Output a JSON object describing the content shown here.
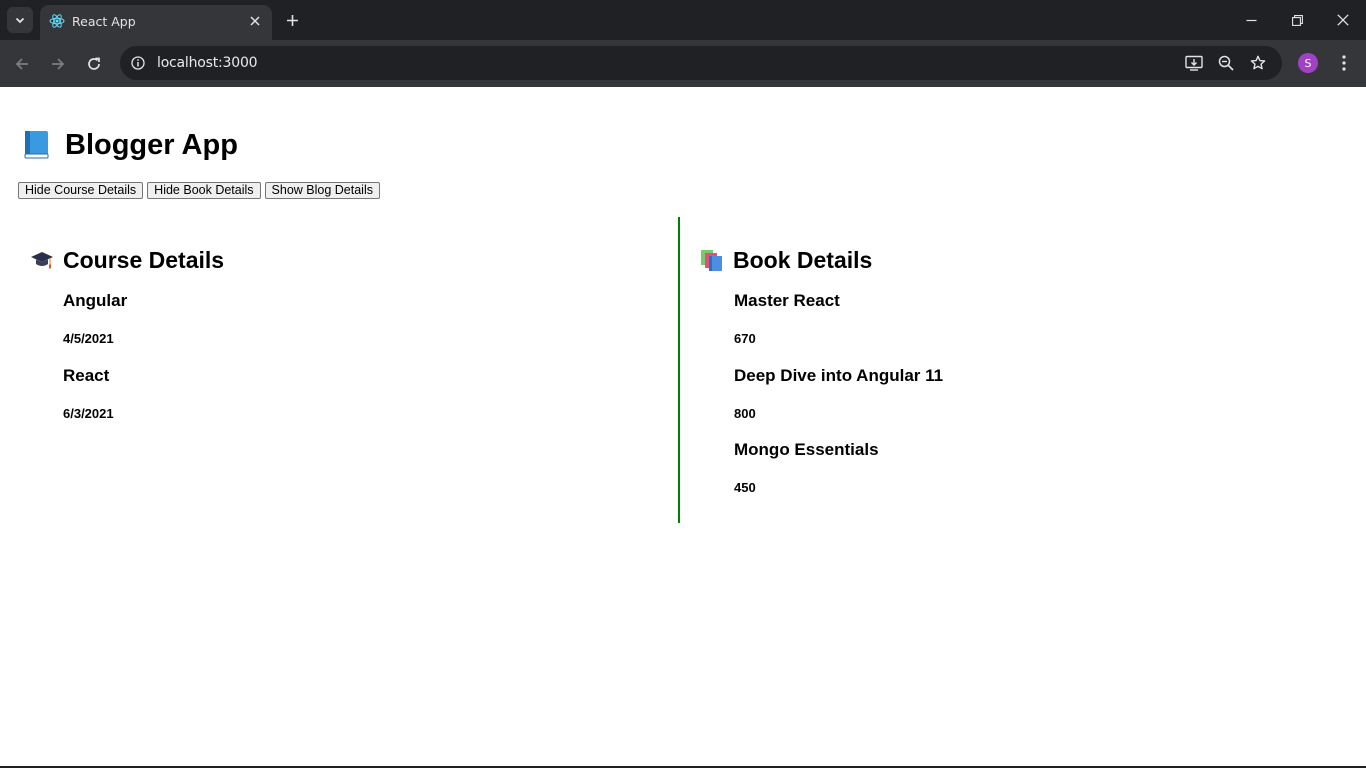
{
  "browser": {
    "tab_title": "React App",
    "url": "localhost:3000",
    "profile_initial": "S"
  },
  "app": {
    "title": "Blogger App",
    "buttons": {
      "course": "Hide Course Details",
      "book": "Hide Book Details",
      "blog": "Show Blog Details"
    }
  },
  "course_section": {
    "heading": "Course Details",
    "items": [
      {
        "name": "Angular",
        "date": "4/5/2021"
      },
      {
        "name": "React",
        "date": "6/3/2021"
      }
    ]
  },
  "book_section": {
    "heading": "Book Details",
    "items": [
      {
        "name": "Master React",
        "price": "670"
      },
      {
        "name": "Deep Dive into Angular 11",
        "price": "800"
      },
      {
        "name": "Mongo Essentials",
        "price": "450"
      }
    ]
  },
  "colors": {
    "divider": "#008000",
    "tab_bar": "#1f2124",
    "toolbar": "#35363a",
    "avatar": "#a142c4"
  }
}
